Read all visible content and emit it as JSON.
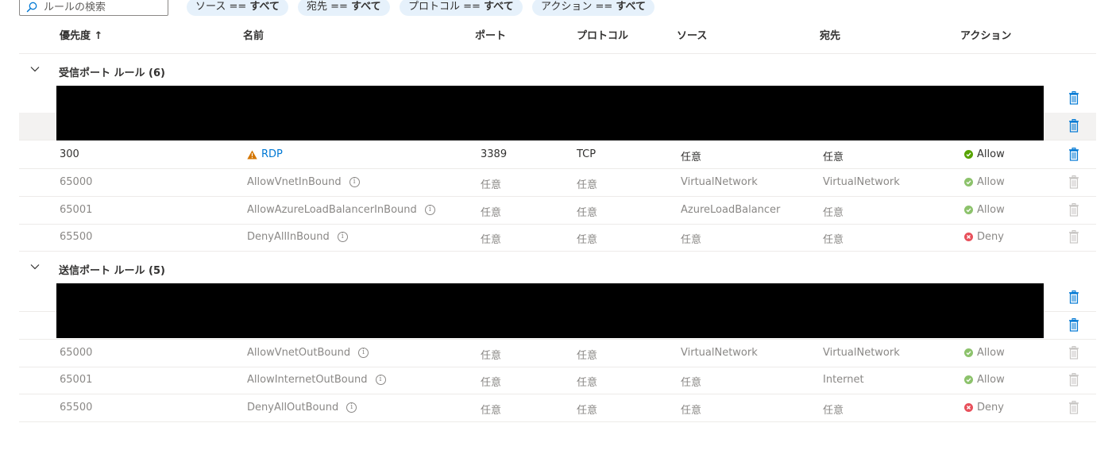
{
  "search": {
    "placeholder": "ルールの検索",
    "icon": "search-icon"
  },
  "filters": [
    {
      "key": "ソース ==",
      "value": "すべて"
    },
    {
      "key": "宛先 ==",
      "value": "すべて"
    },
    {
      "key": "プロトコル ==",
      "value": "すべて"
    },
    {
      "key": "アクション ==",
      "value": "すべて"
    }
  ],
  "columns": {
    "priority": "優先度 ↑",
    "name": "名前",
    "port": "ポート",
    "protocol": "プロトコル",
    "source": "ソース",
    "destination": "宛先",
    "action": "アクション"
  },
  "inbound": {
    "label": "受信ポート ルール (6)",
    "rows": [
      {
        "priority": "300",
        "name": "RDP",
        "port": "3389",
        "protocol": "TCP",
        "source": "任意",
        "destination": "任意",
        "action": "Allow"
      },
      {
        "priority": "65000",
        "name": "AllowVnetInBound",
        "port": "任意",
        "protocol": "任意",
        "source": "VirtualNetwork",
        "destination": "VirtualNetwork",
        "action": "Allow"
      },
      {
        "priority": "65001",
        "name": "AllowAzureLoadBalancerInBound",
        "port": "任意",
        "protocol": "任意",
        "source": "AzureLoadBalancer",
        "destination": "任意",
        "action": "Allow"
      },
      {
        "priority": "65500",
        "name": "DenyAllInBound",
        "port": "任意",
        "protocol": "任意",
        "source": "任意",
        "destination": "任意",
        "action": "Deny"
      }
    ]
  },
  "outbound": {
    "label": "送信ポート ルール (5)",
    "rows": [
      {
        "priority": "65000",
        "name": "AllowVnetOutBound",
        "port": "任意",
        "protocol": "任意",
        "source": "VirtualNetwork",
        "destination": "VirtualNetwork",
        "action": "Allow"
      },
      {
        "priority": "65001",
        "name": "AllowInternetOutBound",
        "port": "任意",
        "protocol": "任意",
        "source": "任意",
        "destination": "Internet",
        "action": "Allow"
      },
      {
        "priority": "65500",
        "name": "DenyAllOutBound",
        "port": "任意",
        "protocol": "任意",
        "source": "任意",
        "destination": "任意",
        "action": "Deny"
      }
    ]
  },
  "colors": {
    "accent": "#0078d4",
    "allow": "#57a300",
    "deny": "#e8505b",
    "warning": "#d47500"
  }
}
